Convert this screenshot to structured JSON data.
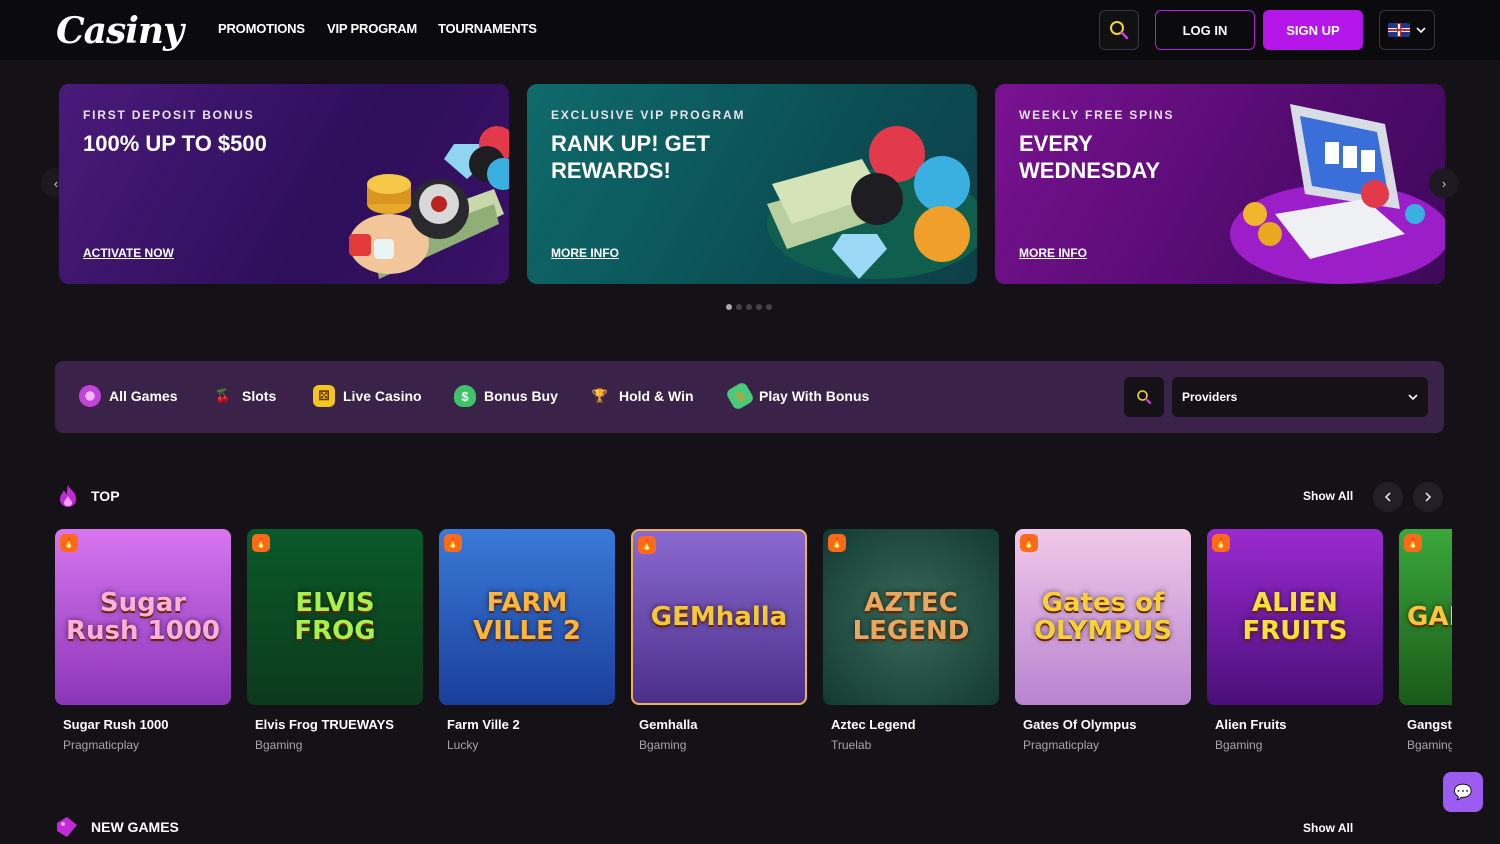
{
  "header": {
    "logo": "Casiny",
    "nav": [
      "PROMOTIONS",
      "VIP PROGRAM",
      "TOURNAMENTS"
    ],
    "login": "LOG IN",
    "signup": "SIGN UP",
    "language_icon": "uk-flag-icon"
  },
  "banners": [
    {
      "kicker": "FIRST DEPOSIT BONUS",
      "title": "100% UP TO $500",
      "link": "ACTIVATE NOW"
    },
    {
      "kicker": "EXCLUSIVE VIP PROGRAM",
      "title": "RANK UP! GET REWARDS!",
      "link": "MORE INFO"
    },
    {
      "kicker": "WEEKLY FREE SPINS",
      "title": "EVERY WEDNESDAY",
      "link": "MORE INFO"
    }
  ],
  "carousel": {
    "dots": 5,
    "active": 0
  },
  "categories": [
    {
      "label": "All Games",
      "icon": "all-games-icon"
    },
    {
      "label": "Slots",
      "icon": "cherry-icon"
    },
    {
      "label": "Live Casino",
      "icon": "dice-icon"
    },
    {
      "label": "Bonus Buy",
      "icon": "money-bag-icon"
    },
    {
      "label": "Hold & Win",
      "icon": "trophy-icon"
    },
    {
      "label": "Play With Bonus",
      "icon": "bonus-icon"
    }
  ],
  "providers": {
    "placeholder": "Providers"
  },
  "top": {
    "title": "TOP",
    "show_all": "Show All",
    "games": [
      {
        "name": "Sugar Rush 1000",
        "provider": "Pragmaticplay",
        "art": "Sugar Rush 1000",
        "color": "#b14fd6"
      },
      {
        "name": "Elvis Frog TRUEWAYS",
        "provider": "Bgaming",
        "art": "ELVIS FROG",
        "color": "#1c8a2c"
      },
      {
        "name": "Farm Ville 2",
        "provider": "Lucky",
        "art": "FARM VILLE 2",
        "color": "#2a5fc0"
      },
      {
        "name": "Gemhalla",
        "provider": "Bgaming",
        "art": "GEMhalla",
        "color": "#6a4ab0"
      },
      {
        "name": "Aztec Legend",
        "provider": "Truelab",
        "art": "AZTEC LEGEND",
        "color": "#1d4e46"
      },
      {
        "name": "Gates Of Olympus",
        "provider": "Pragmaticplay",
        "art": "Gates of OLYMPUS",
        "color": "#c9a0d8"
      },
      {
        "name": "Alien Fruits",
        "provider": "Bgaming",
        "art": "ALIEN FRUITS",
        "color": "#7a1fa8"
      },
      {
        "name": "Gangsta",
        "provider": "Bgaming",
        "art": "GAN",
        "color": "#2b7a2b"
      }
    ]
  },
  "new_games": {
    "title": "NEW GAMES",
    "show_all": "Show All"
  }
}
